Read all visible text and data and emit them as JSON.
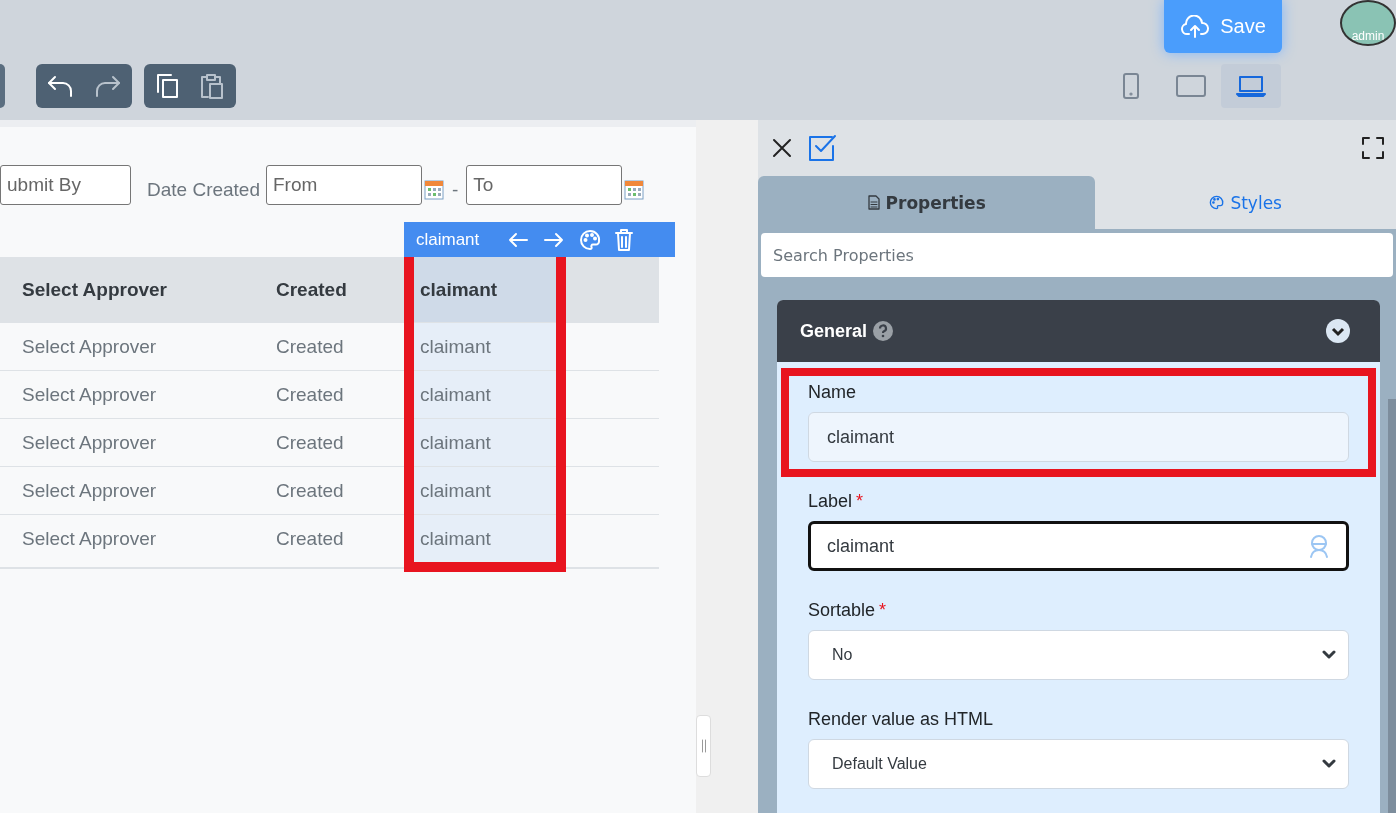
{
  "header": {
    "save_button": "Save",
    "avatar_label": "admin"
  },
  "toolbar": {
    "devices": [
      {
        "kind": "phone",
        "selected": false
      },
      {
        "kind": "tablet",
        "selected": false
      },
      {
        "kind": "laptop",
        "selected": true
      }
    ]
  },
  "filters": {
    "submit_by": {
      "placeholder": "ubmit By"
    },
    "date_label": "Date Created",
    "from": {
      "placeholder": "From"
    },
    "separator": "-",
    "to": {
      "placeholder": "To"
    }
  },
  "column_toolbar": {
    "label": "claimant"
  },
  "table": {
    "columns": [
      {
        "label": "Select Approver",
        "selected": false
      },
      {
        "label": "Created",
        "selected": false
      },
      {
        "label": "claimant",
        "selected": true
      }
    ],
    "rows": [
      [
        "Select Approver",
        "Created",
        "claimant"
      ],
      [
        "Select Approver",
        "Created",
        "claimant"
      ],
      [
        "Select Approver",
        "Created",
        "claimant"
      ],
      [
        "Select Approver",
        "Created",
        "claimant"
      ],
      [
        "Select Approver",
        "Created",
        "claimant"
      ]
    ]
  },
  "panel": {
    "tabs": [
      {
        "label": "Properties",
        "kind": "properties",
        "selected": true
      },
      {
        "label": "Styles",
        "kind": "styles",
        "selected": false
      }
    ],
    "search": {
      "placeholder": "Search Properties"
    },
    "section": {
      "title": "General",
      "expanded": true
    },
    "fields": [
      {
        "kind": "input",
        "label": "Name",
        "value": "claimant",
        "highlighted": true,
        "focused": false
      },
      {
        "kind": "input",
        "label": "Label",
        "required_mark": "*",
        "value": "claimant",
        "highlighted": false,
        "focused": true
      },
      {
        "kind": "select",
        "label": "Sortable",
        "required_mark": "*",
        "value": "No",
        "highlighted": false
      },
      {
        "kind": "select",
        "label": "Render value as HTML",
        "value": "Default Value",
        "highlighted": false
      }
    ]
  }
}
